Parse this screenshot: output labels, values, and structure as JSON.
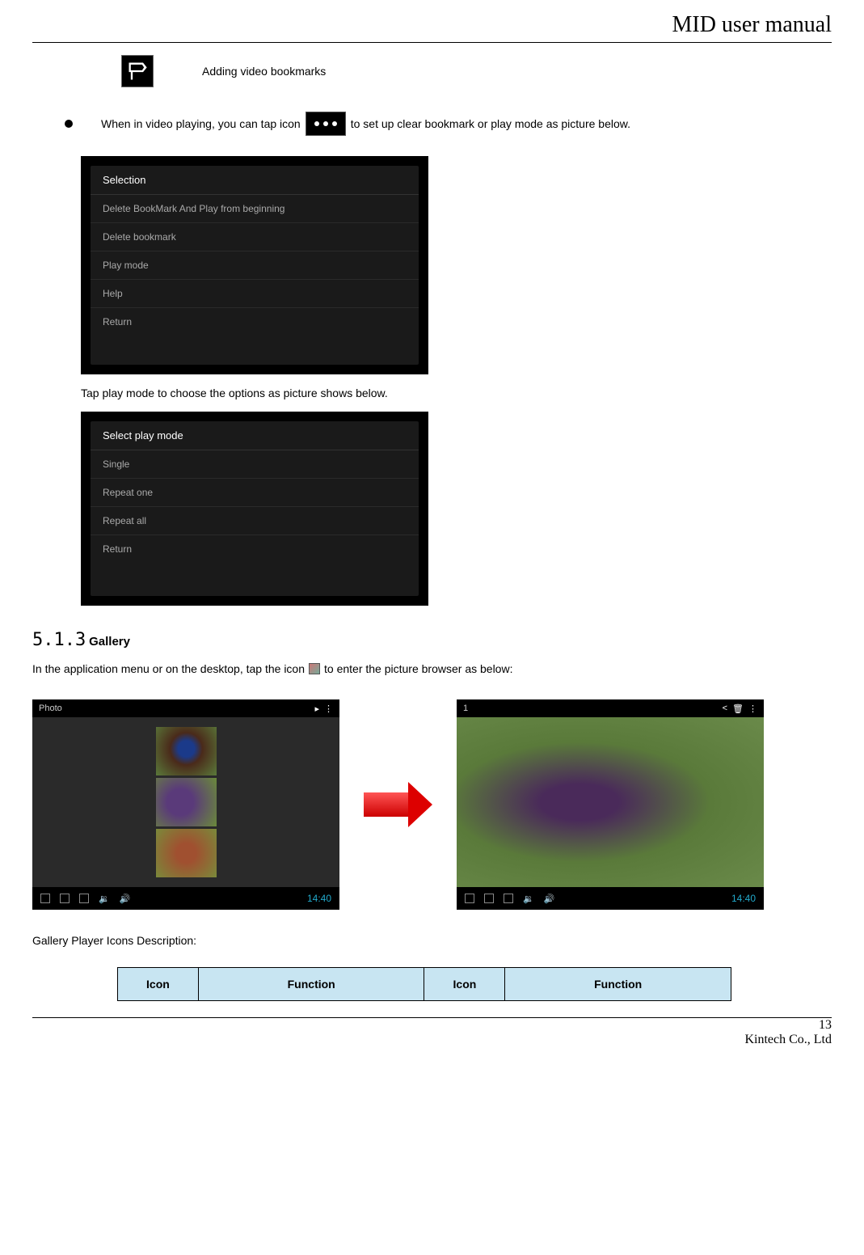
{
  "header": {
    "title": "MID user manual"
  },
  "footer": {
    "page": "13",
    "company": "Kintech Co., Ltd"
  },
  "bookmark": {
    "label": "Adding video bookmarks"
  },
  "instruction1": {
    "pre": "When in video playing, you can tap icon",
    "post": " to set up clear bookmark or play mode as picture below."
  },
  "screenshot1": {
    "title": "Selection",
    "items": [
      "Delete BookMark And Play from beginning",
      "Delete bookmark",
      "Play mode",
      "Help",
      "Return"
    ]
  },
  "instruction2": {
    "text": "Tap play mode to choose the options as picture shows below."
  },
  "screenshot2": {
    "title": "Select play mode",
    "items": [
      "Single",
      "Repeat one",
      "Repeat all",
      "Return"
    ]
  },
  "section": {
    "number": "5.1.3",
    "title": "Gallery"
  },
  "gallery_text": {
    "pre": "In the application menu or on the desktop, tap the icon ",
    "post": " to enter the picture browser as below:"
  },
  "gallery_bar": {
    "photo_label": "Photo",
    "time": "14:40",
    "count": "1"
  },
  "icons_desc": {
    "label": "Gallery Player Icons Description:"
  },
  "table": {
    "headers": {
      "icon1": "Icon",
      "func1": "Function",
      "icon2": "Icon",
      "func2": "Function"
    }
  }
}
